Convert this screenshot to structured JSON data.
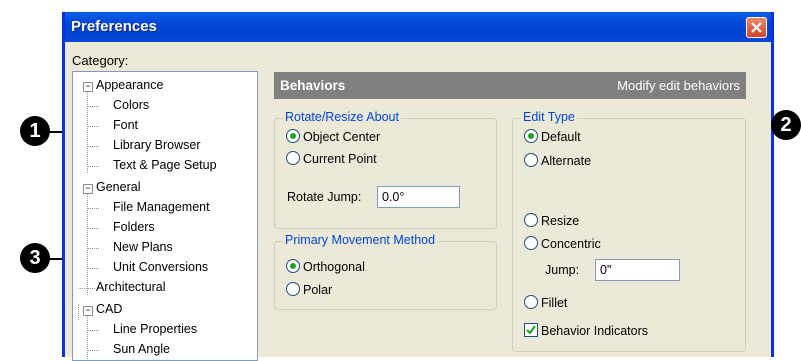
{
  "window": {
    "title": "Preferences"
  },
  "category_label": "Category:",
  "tree": [
    {
      "label": "Appearance",
      "level": 0,
      "expandable": true
    },
    {
      "label": "Colors",
      "level": 1
    },
    {
      "label": "Font",
      "level": 1
    },
    {
      "label": "Library Browser",
      "level": 1
    },
    {
      "label": "Text & Page Setup",
      "level": 1
    },
    {
      "label": "General",
      "level": 0,
      "expandable": true
    },
    {
      "label": "File Management",
      "level": 1
    },
    {
      "label": "Folders",
      "level": 1
    },
    {
      "label": "New Plans",
      "level": 1
    },
    {
      "label": "Unit Conversions",
      "level": 1
    },
    {
      "label": "Architectural",
      "level": 0
    },
    {
      "label": "CAD",
      "level": 0,
      "expandable": true
    },
    {
      "label": "Line Properties",
      "level": 1
    },
    {
      "label": "Sun Angle",
      "level": 1
    }
  ],
  "expander_symbol": "−",
  "panel": {
    "title": "Behaviors",
    "subtitle": "Modify edit behaviors"
  },
  "rotate_group": {
    "legend": "Rotate/Resize About",
    "options": [
      "Object Center",
      "Current Point"
    ],
    "selected": 0,
    "jump_label": "Rotate Jump:",
    "jump_value": "0.0°"
  },
  "movement_group": {
    "legend": "Primary Movement Method",
    "options": [
      "Orthogonal",
      "Polar"
    ],
    "selected": 0
  },
  "edit_group": {
    "legend": "Edit Type",
    "type_options": [
      "Default",
      "Alternate"
    ],
    "type_selected": 0,
    "mode_options": [
      "Resize",
      "Concentric",
      "Fillet"
    ],
    "jump_label": "Jump:",
    "jump_value": "0\"",
    "behavior_indicators_label": "Behavior Indicators",
    "behavior_indicators_checked": true
  },
  "callouts": [
    "1",
    "2",
    "3"
  ],
  "colors": {
    "title_bar": "#0246d7",
    "legend_text": "#0046d5",
    "close_button": "#d2452a",
    "radio_dot": "#21a121"
  }
}
